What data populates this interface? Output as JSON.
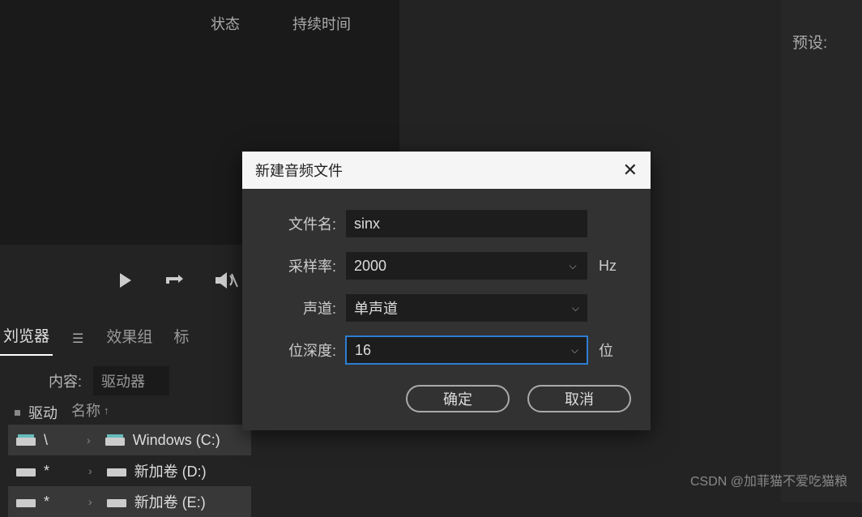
{
  "header": {
    "col_status": "状态",
    "col_duration": "持续时间"
  },
  "right_panel": {
    "preset_label": "预设:"
  },
  "tabs": {
    "browser": "刘览器",
    "effects": "效果组",
    "markers": "标"
  },
  "content": {
    "label": "内容:",
    "drive_select": "驱动器"
  },
  "drives": {
    "section_label": "驱动",
    "name_header": "名称",
    "items": [
      {
        "label": "\\",
        "name": "Windows (C:)"
      },
      {
        "label": "*",
        "name": "新加卷 (D:)"
      },
      {
        "label": "*",
        "name": "新加卷 (E:)"
      }
    ]
  },
  "dialog": {
    "title": "新建音频文件",
    "fields": {
      "filename_label": "文件名:",
      "filename_value": "sinx",
      "samplerate_label": "采样率:",
      "samplerate_value": "2000",
      "samplerate_unit": "Hz",
      "channels_label": "声道:",
      "channels_value": "单声道",
      "bitdepth_label": "位深度:",
      "bitdepth_value": "16",
      "bitdepth_unit": "位"
    },
    "buttons": {
      "ok": "确定",
      "cancel": "取消"
    }
  },
  "watermark": "CSDN @加菲猫不爱吃猫粮"
}
